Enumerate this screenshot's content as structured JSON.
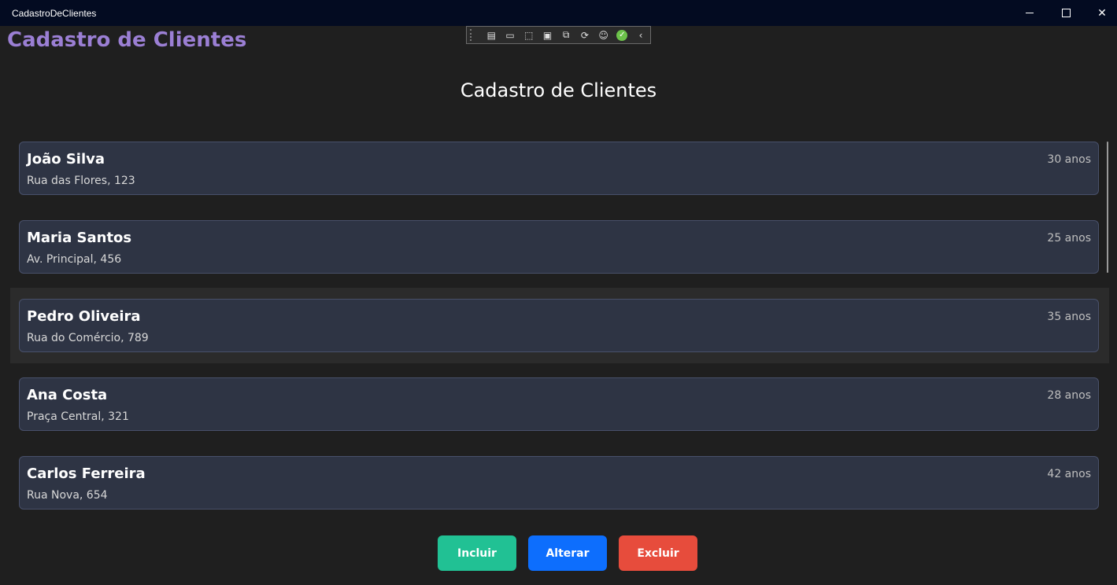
{
  "window": {
    "title": "CadastroDeClientes"
  },
  "header": {
    "title": "Cadastro de Clientes",
    "color": "#9b7fd4"
  },
  "page": {
    "title": "Cadastro de Clientes"
  },
  "devtools": {
    "icons": [
      "live-visual-tree-icon",
      "record-icon",
      "select-element-icon",
      "display-layout-adorners-icon",
      "track-focus-icon",
      "hot-reload-icon",
      "accessibility-icon",
      "binding-check-icon",
      "collapse-chevron-icon"
    ]
  },
  "clients": [
    {
      "name": "João Silva",
      "address": "Rua das Flores, 123",
      "age": "30 anos"
    },
    {
      "name": "Maria Santos",
      "address": "Av. Principal, 456",
      "age": "25 anos"
    },
    {
      "name": "Pedro Oliveira",
      "address": "Rua do Comércio, 789",
      "age": "35 anos",
      "hovered": true
    },
    {
      "name": "Ana Costa",
      "address": "Praça Central, 321",
      "age": "28 anos"
    },
    {
      "name": "Carlos Ferreira",
      "address": "Rua Nova, 654",
      "age": "42 anos"
    }
  ],
  "buttons": {
    "include": {
      "label": "Incluir",
      "color": "#21c194"
    },
    "edit": {
      "label": "Alterar",
      "color": "#0d6efd"
    },
    "delete": {
      "label": "Excluir",
      "color": "#e74c3c"
    }
  },
  "colors": {
    "background": "#1f1f1f",
    "card": "#2e3444",
    "titlebar": "#030b21"
  }
}
